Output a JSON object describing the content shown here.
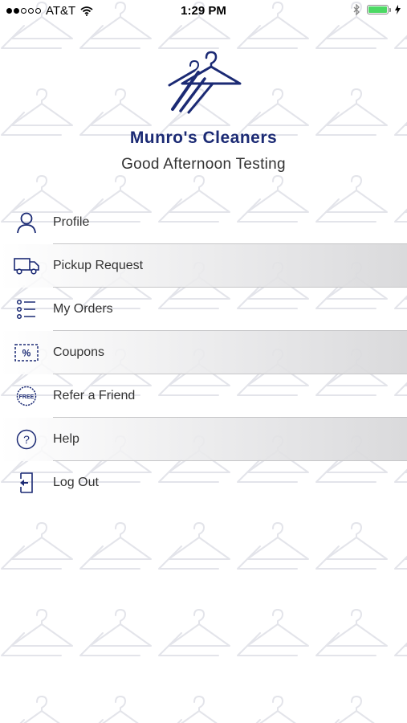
{
  "status_bar": {
    "carrier": "AT&T",
    "time": "1:29 PM"
  },
  "header": {
    "brand_name": "Munro's Cleaners",
    "greeting": "Good Afternoon Testing"
  },
  "menu": {
    "items": [
      {
        "label": "Profile",
        "icon": "person-icon"
      },
      {
        "label": "Pickup Request",
        "icon": "truck-icon"
      },
      {
        "label": "My Orders",
        "icon": "list-icon"
      },
      {
        "label": "Coupons",
        "icon": "coupon-icon"
      },
      {
        "label": "Refer a Friend",
        "icon": "free-badge-icon",
        "icon_text": "FREE"
      },
      {
        "label": "Help",
        "icon": "help-icon"
      },
      {
        "label": "Log Out",
        "icon": "logout-icon"
      }
    ]
  },
  "colors": {
    "brand": "#1b2a74",
    "battery": "#4cd964",
    "icon": "#1b2a74"
  }
}
